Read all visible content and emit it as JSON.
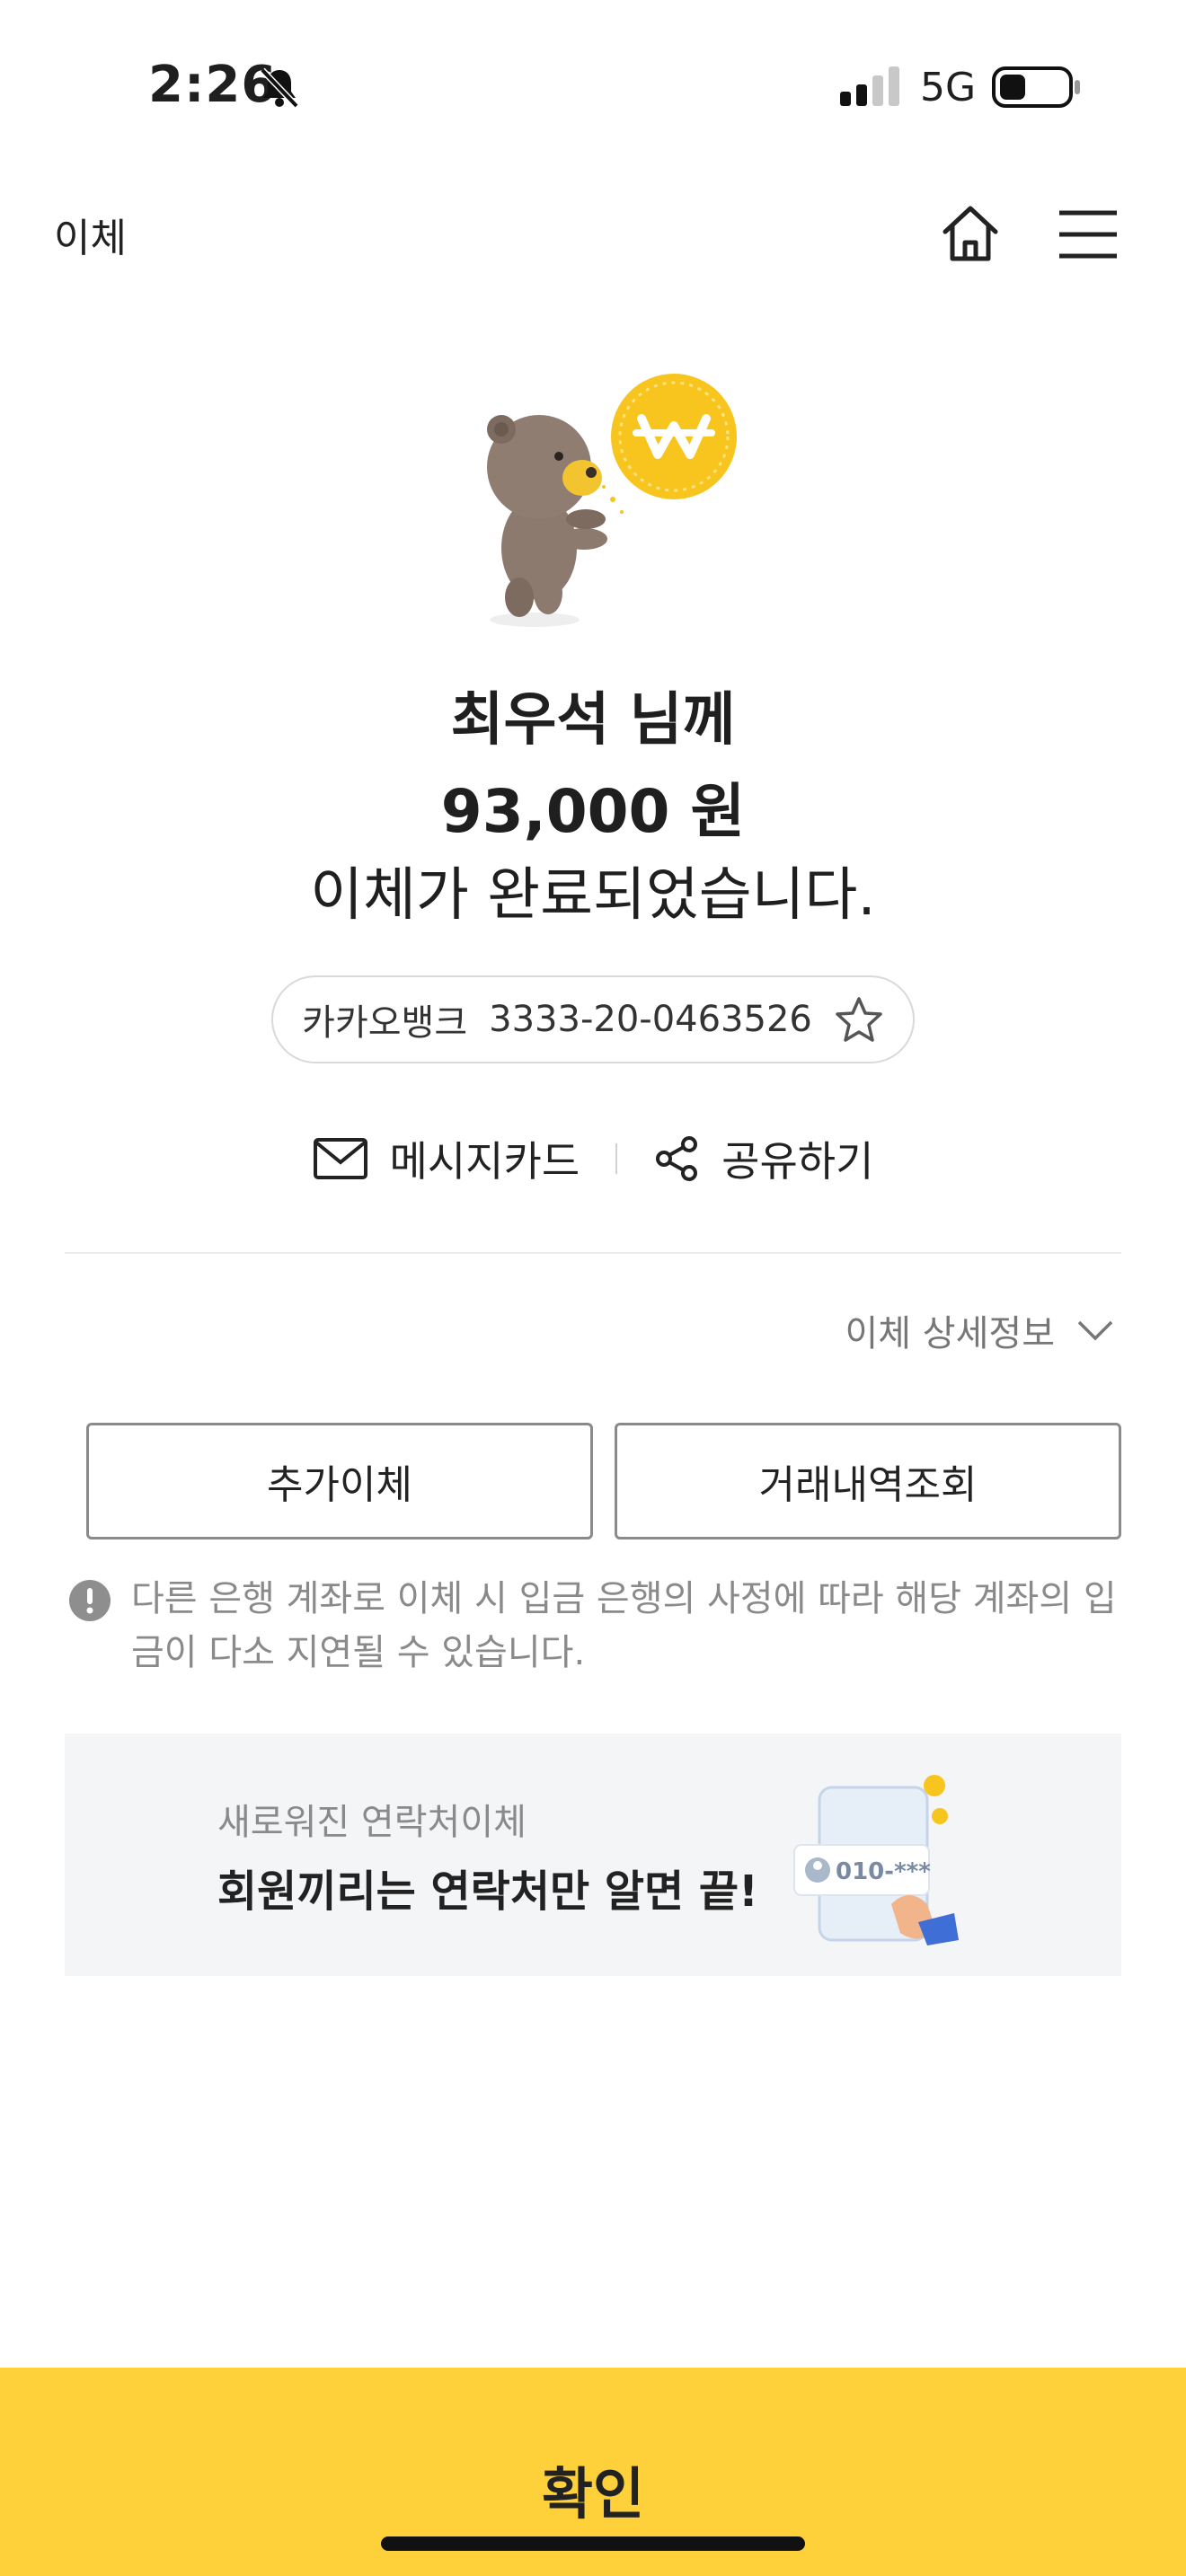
{
  "status": {
    "time": "2:26",
    "network": "5G"
  },
  "header": {
    "title": "이체"
  },
  "result": {
    "recipient": "최우석 님께",
    "amount": "93,000 원",
    "message": "이체가 완료되었습니다."
  },
  "account": {
    "bank": "카카오뱅크",
    "number": "3333-20-0463526"
  },
  "actions": {
    "message_card": "메시지카드",
    "share": "공유하기"
  },
  "details": {
    "toggle_label": "이체 상세정보"
  },
  "buttons": {
    "additional_transfer": "추가이체",
    "history": "거래내역조회"
  },
  "notice": {
    "text": "다른 은행 계좌로 이체 시 입금 은행의 사정에 따라 해당 계좌의 입금이 다소 지연될 수 있습니다."
  },
  "banner": {
    "subtitle": "새로워진 연락처이체",
    "title": "회원끼리는 연락처만 알면 끝!",
    "art_text": "010-***"
  },
  "footer": {
    "confirm": "확인"
  },
  "colors": {
    "accent": "#fed13a",
    "coin": "#f7c51e",
    "banner_bg": "#f4f5f7"
  }
}
